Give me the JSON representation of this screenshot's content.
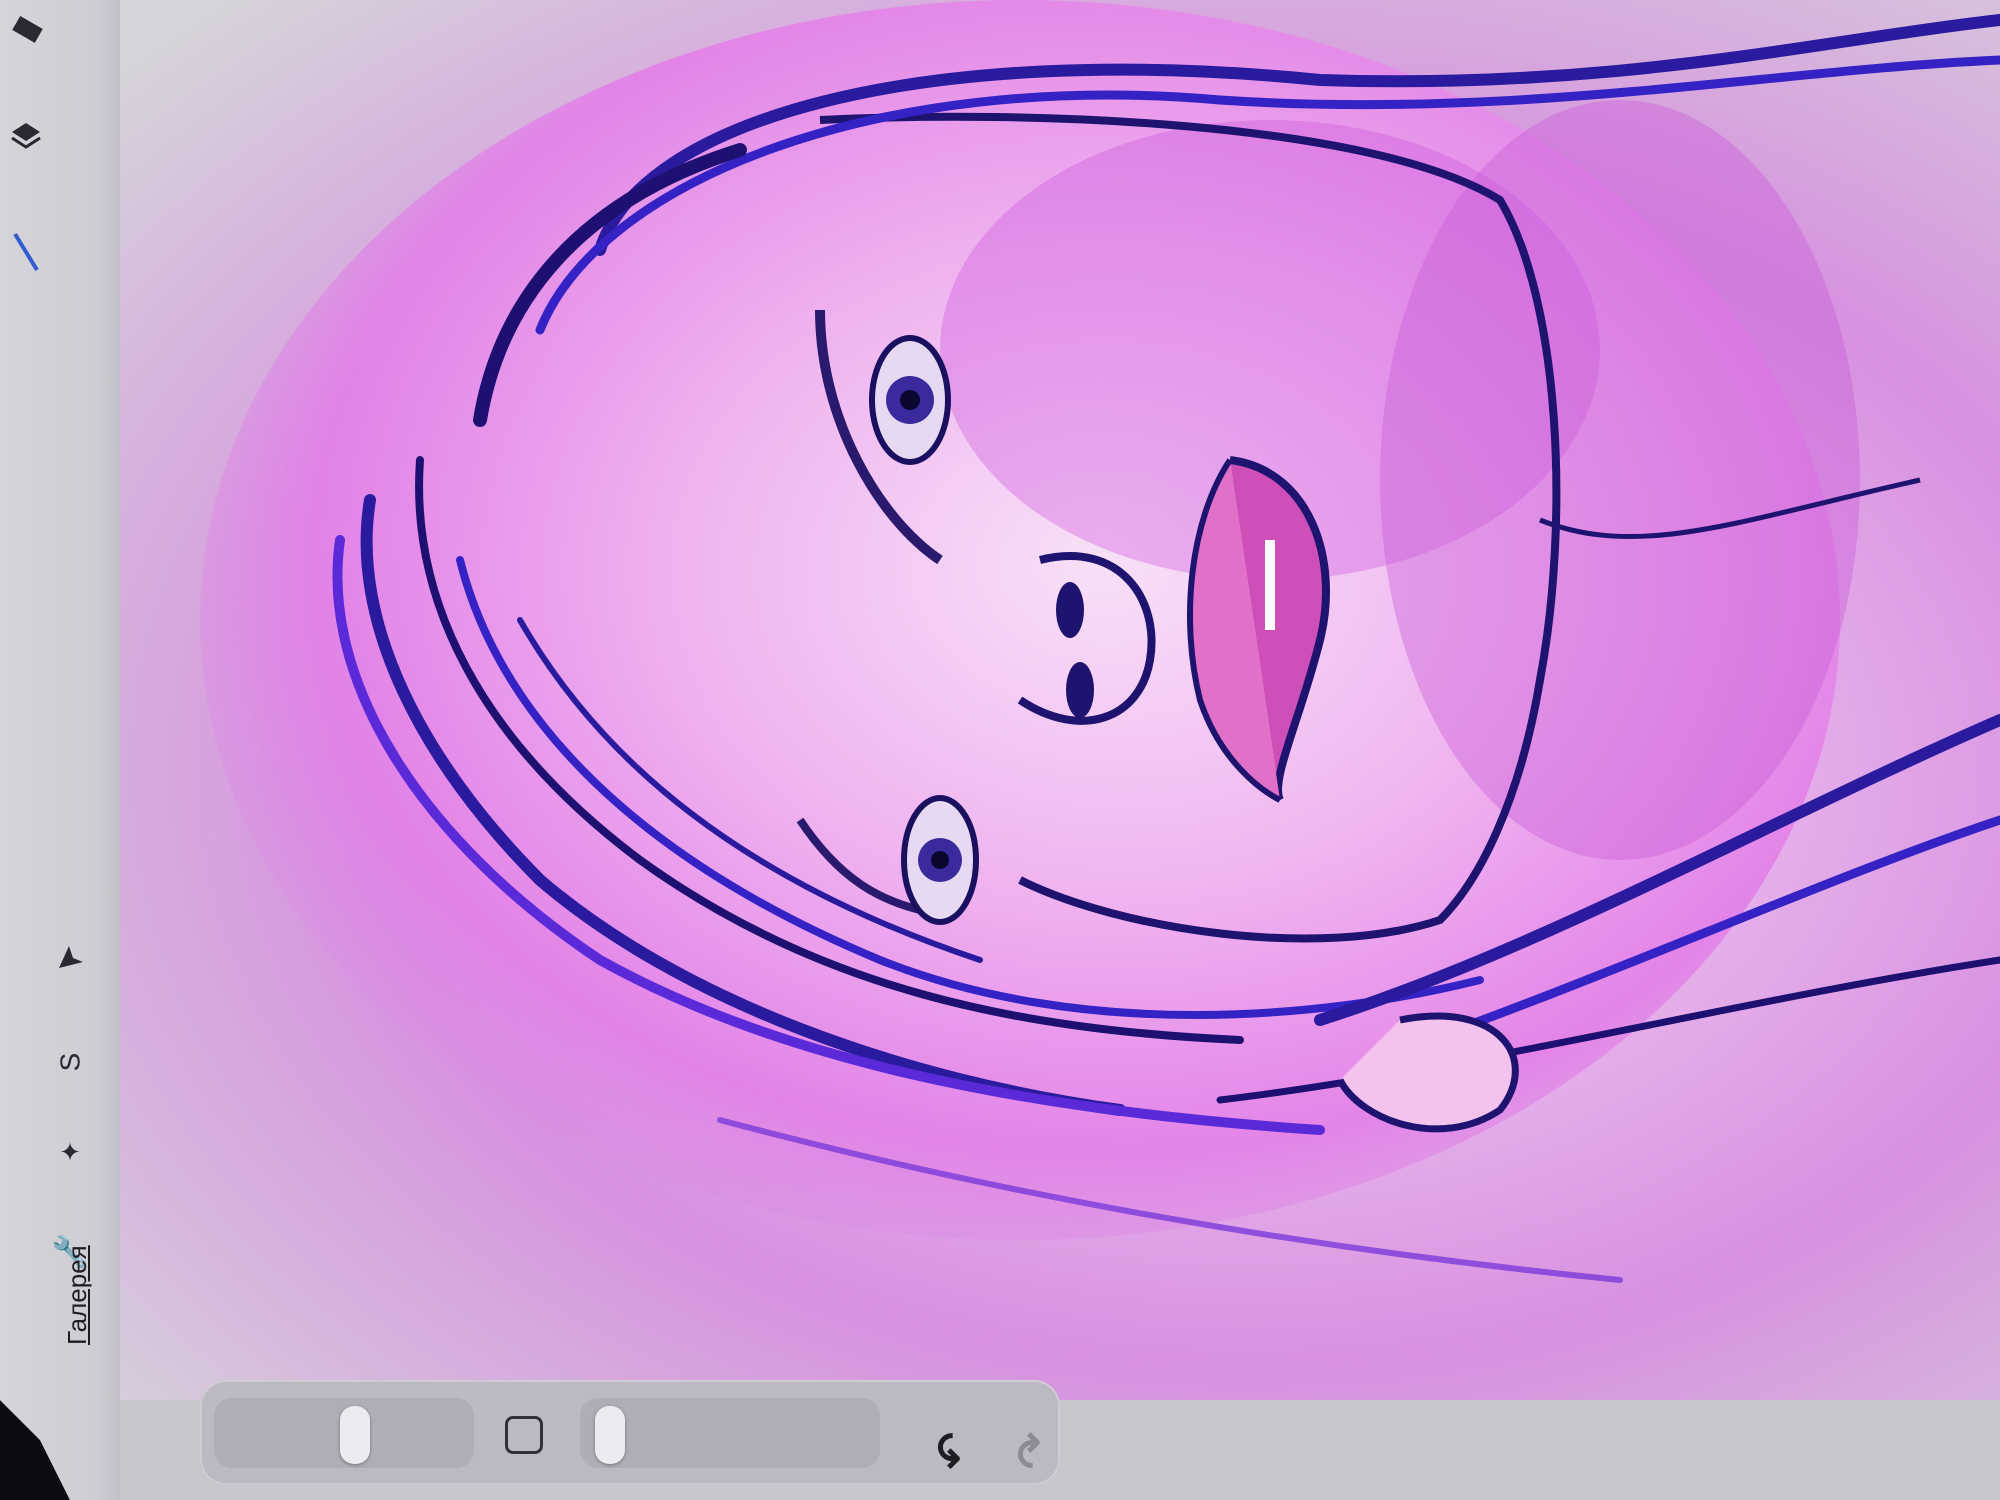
{
  "app": {
    "gallery_label": "Галерея"
  },
  "toolbar": {
    "tools": [
      {
        "icon": "brush-icon"
      },
      {
        "icon": "smudge-icon"
      },
      {
        "icon": "eraser-icon"
      },
      {
        "icon": "layers-icon"
      },
      {
        "icon": "color-picker-icon"
      }
    ],
    "actions": [
      {
        "icon": "selection-arrow-icon"
      },
      {
        "icon": "transform-s-icon"
      },
      {
        "icon": "adjustments-magic-icon"
      },
      {
        "icon": "wrench-icon"
      }
    ]
  },
  "sidebar": {
    "brush_size_icon": "slider-thumb",
    "modify_icon": "square-icon",
    "undo_icon": "undo-arrow-icon",
    "redo_icon": "redo-arrow-icon"
  },
  "colors": {
    "accent_stroke": "#2a1a9e",
    "canvas_pink": "#e7b3ec",
    "hair_blue": "#3522c4",
    "background_grey": "#c9c6ce"
  }
}
